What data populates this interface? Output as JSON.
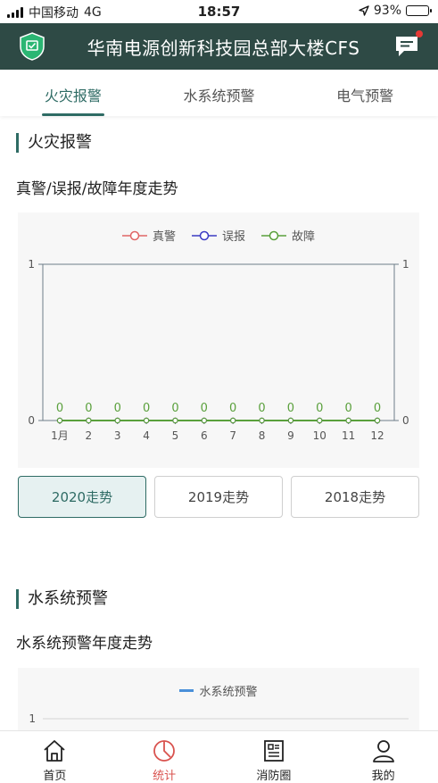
{
  "status_bar": {
    "carrier": "中国移动",
    "network": "4G",
    "time": "18:57",
    "battery": "93%",
    "battery_level": 0.93
  },
  "header": {
    "title": "华南电源创新科技园总部大楼CFS",
    "logo_icon": "shield-check-icon",
    "message_icon": "chat-bubble-icon",
    "notification_color": "#e53935",
    "bg_color": "#2e4a45"
  },
  "tabs": [
    {
      "label": "火灾报警",
      "active": true
    },
    {
      "label": "水系统预警",
      "active": false
    },
    {
      "label": "电气预警",
      "active": false
    }
  ],
  "fire_section": {
    "title": "火灾报警",
    "subtitle": "真警/误报/故障年度走势",
    "year_buttons": [
      {
        "label": "2020走势",
        "active": true
      },
      {
        "label": "2019走势",
        "active": false
      },
      {
        "label": "2018走势",
        "active": false
      }
    ]
  },
  "water_section": {
    "title": "水系统预警",
    "subtitle": "水系统预警年度走势"
  },
  "chart_data": [
    {
      "type": "line",
      "categories": [
        "1月",
        "2",
        "3",
        "4",
        "5",
        "6",
        "7",
        "8",
        "9",
        "10",
        "11",
        "12"
      ],
      "series": [
        {
          "name": "真警",
          "color": "#e06666",
          "values": [
            0,
            0,
            0,
            0,
            0,
            0,
            0,
            0,
            0,
            0,
            0,
            0
          ]
        },
        {
          "name": "误报",
          "color": "#3b3bc4",
          "values": [
            0,
            0,
            0,
            0,
            0,
            0,
            0,
            0,
            0,
            0,
            0,
            0
          ]
        },
        {
          "name": "故障",
          "color": "#5aa03c",
          "values": [
            0,
            0,
            0,
            0,
            0,
            0,
            0,
            0,
            0,
            0,
            0,
            0
          ]
        }
      ],
      "data_labels": [
        "0",
        "0",
        "0",
        "0",
        "0",
        "0",
        "0",
        "0",
        "0",
        "0",
        "0",
        "0"
      ],
      "y_ticks_left": [
        "1",
        "0"
      ],
      "y_ticks_right": [
        "1",
        "0"
      ],
      "ylim": [
        0,
        1
      ],
      "legend": "top-center"
    },
    {
      "type": "line",
      "series": [
        {
          "name": "水系统预警",
          "color": "#4a90d9",
          "values": []
        }
      ],
      "y_ticks_left": [
        "1"
      ],
      "legend": "top-center"
    }
  ],
  "bottom_nav": [
    {
      "label": "首页",
      "icon": "home-icon",
      "active": false
    },
    {
      "label": "统计",
      "icon": "pie-chart-icon",
      "active": true
    },
    {
      "label": "消防圈",
      "icon": "newspaper-icon",
      "active": false
    },
    {
      "label": "我的",
      "icon": "user-icon",
      "active": false
    }
  ]
}
